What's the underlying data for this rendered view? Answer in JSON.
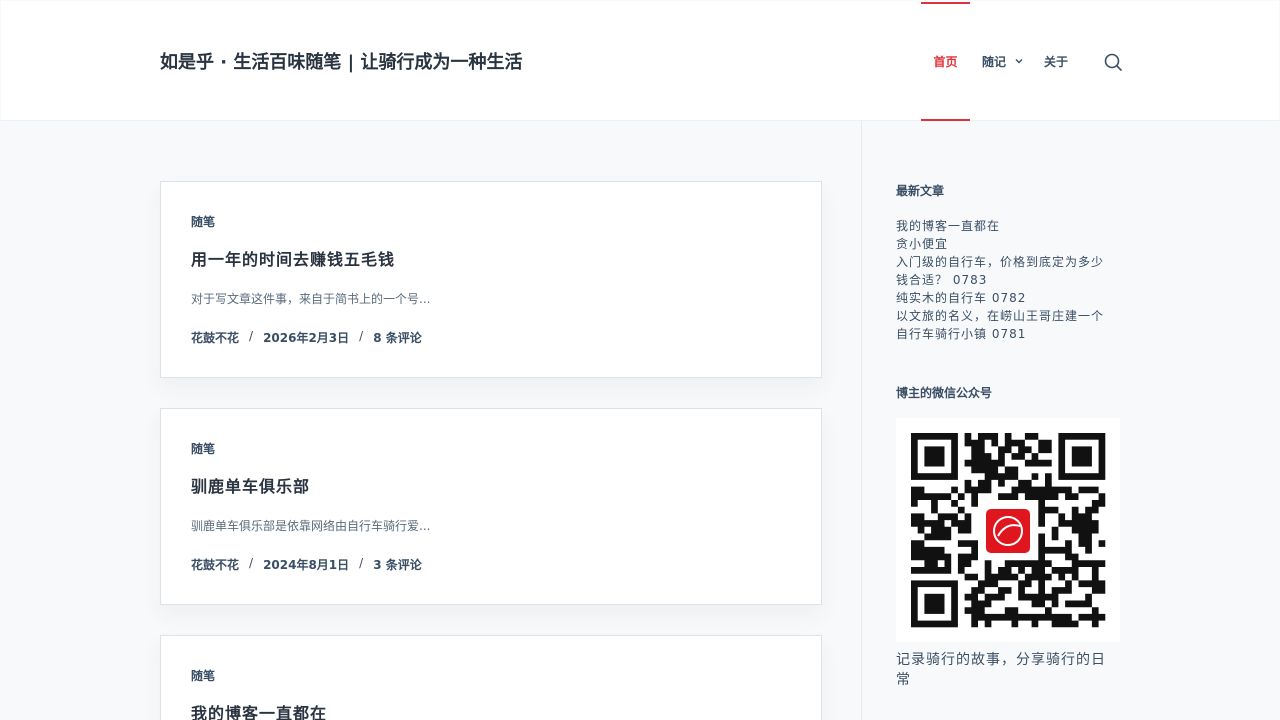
{
  "header": {
    "site_title": "如是乎 · 生活百味随笔 | 让骑行成为一种生活",
    "nav": {
      "home": "首页",
      "notes": "随记",
      "about": "关于"
    },
    "accent_color": "#e0323c"
  },
  "posts": [
    {
      "category": "随笔",
      "title": "用一年的时间去赚钱五毛钱",
      "excerpt": "对于写文章这件事，来自于简书上的一个号...",
      "author": "花鼓不花",
      "date": "2026年2月3日",
      "comments": "8 条评论"
    },
    {
      "category": "随笔",
      "title": "驯鹿单车俱乐部",
      "excerpt": "驯鹿单车俱乐部是依靠网络由自行车骑行爱...",
      "author": "花鼓不花",
      "date": "2024年8月1日",
      "comments": "3 条评论"
    },
    {
      "category": "随笔",
      "title": "我的博客一直都在"
    }
  ],
  "sidebar": {
    "recent_title": "最新文章",
    "recent": [
      "我的博客一直都在",
      "贪小便宜",
      "入门级的自行车，价格到底定为多少钱合适？ 0783",
      "纯实木的自行车 0782",
      "以文旅的名义，在崂山王哥庄建一个自行车骑行小镇 0781"
    ],
    "wechat_title": "博主的微信公众号",
    "qr_caption": "记录骑行的故事，分享骑行的日常"
  }
}
